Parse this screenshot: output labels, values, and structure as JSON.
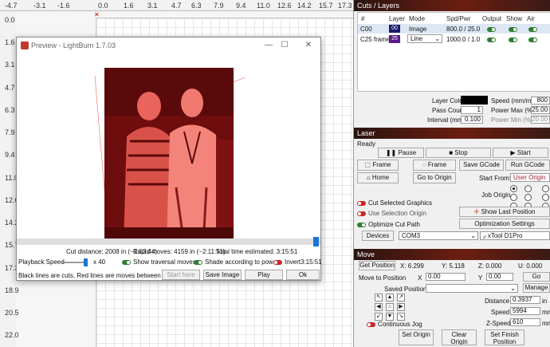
{
  "workspace": {
    "ruler_top": [
      "-4.7",
      "-3.1",
      "-1.6",
      "0.0",
      "1.6",
      "3.1",
      "4.7",
      "6.3",
      "7.9",
      "9.4",
      "11.0",
      "12.6",
      "14.2",
      "15.7",
      "17.3"
    ],
    "ruler_left": [
      "0.0",
      "1.6",
      "3.1",
      "4.7",
      "6.3",
      "7.9",
      "9.4",
      "11.0",
      "12.6",
      "14.2",
      "15.7",
      "17.3",
      "18.9",
      "20.5",
      "22.0"
    ]
  },
  "preview": {
    "title": "Preview - LightBurn 1.7.03",
    "cut_distance": "Cut distance: 2008 in (~1:03:44)",
    "rapid_moves": "Rapid moves: 4159 in (~2:11:51)",
    "total_time": "Total time estimated: 3:15:51",
    "playback_label": "Playback Speed",
    "speed_value": "x 40",
    "show_traversal": "Show traversal moves",
    "shade_power": "Shade according to power",
    "invert": "Invert",
    "elapsed": "3:15:51",
    "legend": "Black lines are cuts, Red lines are moves between cuts",
    "buttons": {
      "start_here": "Start here",
      "save_image": "Save Image",
      "play": "Play",
      "ok": "Ok"
    }
  },
  "cuts": {
    "title": "Cuts / Layers",
    "headers": [
      "#",
      "Layer",
      "Mode",
      "Spd/Pwr",
      "Output",
      "Show",
      "Air"
    ],
    "rows": [
      {
        "name": "C00",
        "layer": "00",
        "mode": "Image",
        "spdpwr": "800.0 / 25.0",
        "color": "#1a1a6e"
      },
      {
        "name": "C25 frame",
        "layer": "25",
        "mode": "Line",
        "spdpwr": "1000.0 / 1.0",
        "color": "#5b1a8a"
      }
    ],
    "layer_color_label": "Layer Color",
    "pass_count_label": "Pass Count",
    "pass_count": "1",
    "interval_label": "Interval (mm)",
    "interval": "0.100",
    "speed_label": "Speed (mm/m)",
    "speed": "800",
    "power_max_label": "Power Max (%)",
    "power_max": "25.00",
    "power_min_label": "Power Min (%)",
    "power_min": "20.00"
  },
  "laser": {
    "title": "Laser",
    "status": "Ready",
    "pause": "Pause",
    "stop": "Stop",
    "start": "Start",
    "frame1": "Frame",
    "frame2": "Frame",
    "save_gcode": "Save GCode",
    "run_gcode": "Run GCode",
    "home": "Home",
    "go_origin": "Go to Origin",
    "start_from_label": "Start From:",
    "start_from": "User Origin",
    "job_origin_label": "Job Origin",
    "cut_selected": "Cut Selected Graphics",
    "use_selection": "Use Selection Origin",
    "optimize_path": "Optimize Cut Path",
    "show_last": "Show Last Position",
    "opt_settings": "Optimization Settings",
    "devices": "Devices",
    "port": "COM3",
    "device_name": "xTool D1Pro"
  },
  "move": {
    "title": "Move",
    "get_position": "Get Position",
    "x_pos": "X: 6.299",
    "y_pos": "Y: 5.118",
    "z_pos": "Z: 0.000",
    "u_pos": "U: 0.000",
    "move_to_label": "Move to Position",
    "x_label": "X",
    "x_val": "0.00",
    "y_label": "Y",
    "y_val": "0.00",
    "go": "Go",
    "saved_label": "Saved Positions:",
    "manage": "Manage",
    "distance_label": "Distance",
    "distance": "0.3937",
    "distance_unit": "in",
    "speed_label": "Speed",
    "speed": "5994",
    "speed_unit": "mm/",
    "zspeed_label": "Z-Speed",
    "zspeed": "610",
    "zspeed_unit": "mm/",
    "continuous_jog": "Continuous Jog",
    "set_origin": "Set Origin",
    "clear_origin": "Clear Origin",
    "set_finish": "Set Finish Position"
  }
}
